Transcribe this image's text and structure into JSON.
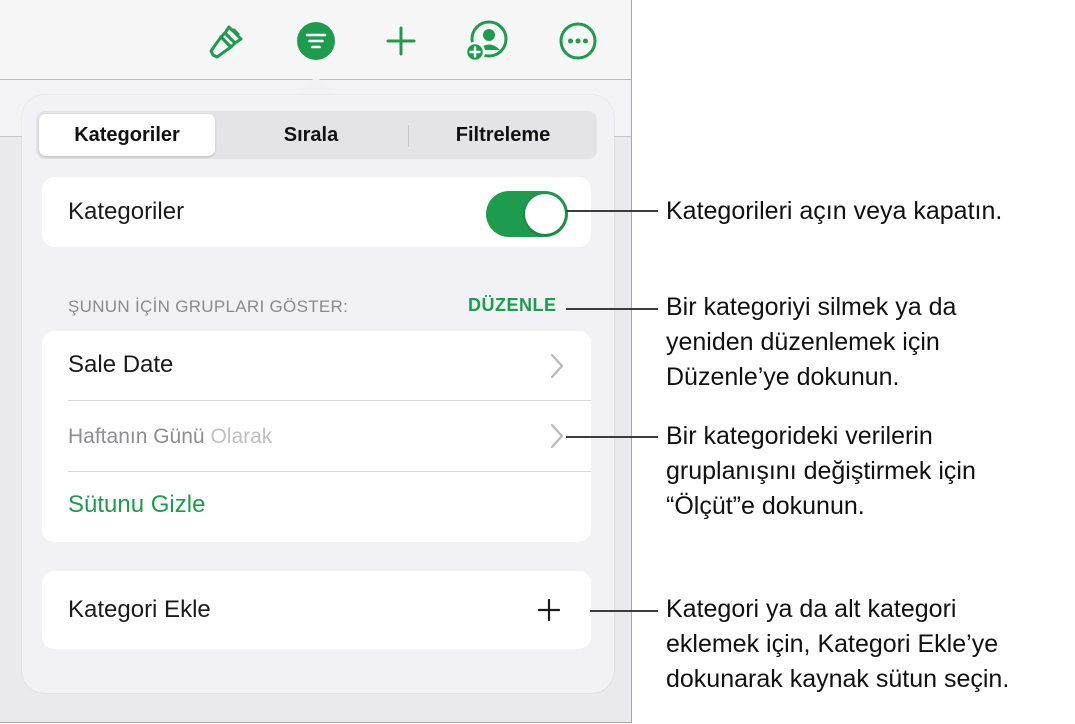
{
  "toolbar": {
    "icons": [
      "paintbrush-icon",
      "organize-icon",
      "plus-icon",
      "collaborate-icon",
      "more-icon"
    ],
    "accent_color": "#1d9c4e"
  },
  "popover": {
    "tabs": [
      {
        "label": "Kategoriler",
        "active": true
      },
      {
        "label": "Sırala",
        "active": false
      },
      {
        "label": "Filtreleme",
        "active": false
      }
    ],
    "categories_toggle": {
      "label": "Kategoriler",
      "on": true
    },
    "section": {
      "header": "ŞUNUN İÇİN GRUPLARI GÖSTER:",
      "edit_label": "DÜZENLE"
    },
    "group": {
      "column_name": "Sale Date",
      "by_value": "Haftanın Günü",
      "by_suffix": "Olarak",
      "hide_column": "Sütunu Gizle"
    },
    "add_category": "Kategori Ekle"
  },
  "callouts": {
    "toggle": [
      "Kategorileri açın veya kapatın."
    ],
    "edit": [
      "Bir kategoriyi silmek ya da",
      "yeniden düzenlemek için",
      "Düzenle’ye dokunun."
    ],
    "grouping": [
      "Bir kategorideki verilerin",
      "gruplanışını değiştirmek için",
      "“Ölçüt”e dokunun."
    ],
    "add": [
      "Kategori ya da alt kategori",
      "eklemek için, Kategori Ekle’ye",
      "dokunarak kaynak sütun seçin."
    ]
  }
}
